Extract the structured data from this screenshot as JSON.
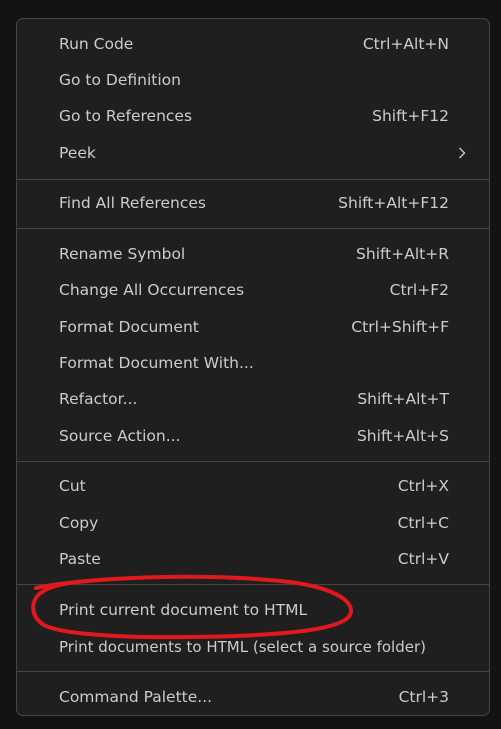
{
  "menu": {
    "groups": [
      {
        "items": [
          {
            "label": "Run Code",
            "shortcut": "Ctrl+Alt+N"
          },
          {
            "label": "Go to Definition",
            "shortcut": ""
          },
          {
            "label": "Go to References",
            "shortcut": "Shift+F12"
          },
          {
            "label": "Peek",
            "shortcut": ""
          }
        ]
      },
      {
        "items": [
          {
            "label": "Find All References",
            "shortcut": "Shift+Alt+F12"
          }
        ]
      },
      {
        "items": [
          {
            "label": "Rename Symbol",
            "shortcut": "Shift+Alt+R"
          },
          {
            "label": "Change All Occurrences",
            "shortcut": "Ctrl+F2"
          },
          {
            "label": "Format Document",
            "shortcut": "Ctrl+Shift+F"
          },
          {
            "label": "Format Document With...",
            "shortcut": ""
          },
          {
            "label": "Refactor...",
            "shortcut": "Shift+Alt+T"
          },
          {
            "label": "Source Action...",
            "shortcut": "Shift+Alt+S"
          }
        ]
      },
      {
        "items": [
          {
            "label": "Cut",
            "shortcut": "Ctrl+X"
          },
          {
            "label": "Copy",
            "shortcut": "Ctrl+C"
          },
          {
            "label": "Paste",
            "shortcut": "Ctrl+V"
          }
        ]
      },
      {
        "items": [
          {
            "label": "Print current document to HTML",
            "shortcut": ""
          },
          {
            "label": "Print documents to HTML (select a source folder)",
            "shortcut": ""
          }
        ]
      },
      {
        "items": [
          {
            "label": "Command Palette...",
            "shortcut": "Ctrl+3"
          }
        ]
      }
    ],
    "submenu_icon": "chevron-right-icon"
  },
  "colors": {
    "background": "#1f1f1f",
    "text": "#cccccc",
    "separator": "#454545",
    "annotation": "#e0191f"
  }
}
